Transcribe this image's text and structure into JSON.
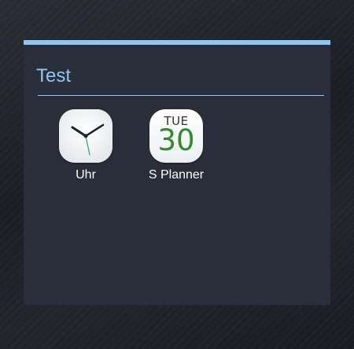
{
  "folder": {
    "title": "Test",
    "accent_color": "#8ec6f0",
    "apps": [
      {
        "label": "Uhr",
        "icon": "clock-icon"
      },
      {
        "label": "S Planner",
        "icon": "calendar-icon",
        "day": "TUE",
        "date": "30",
        "date_color": "#2e8b2e"
      }
    ]
  }
}
